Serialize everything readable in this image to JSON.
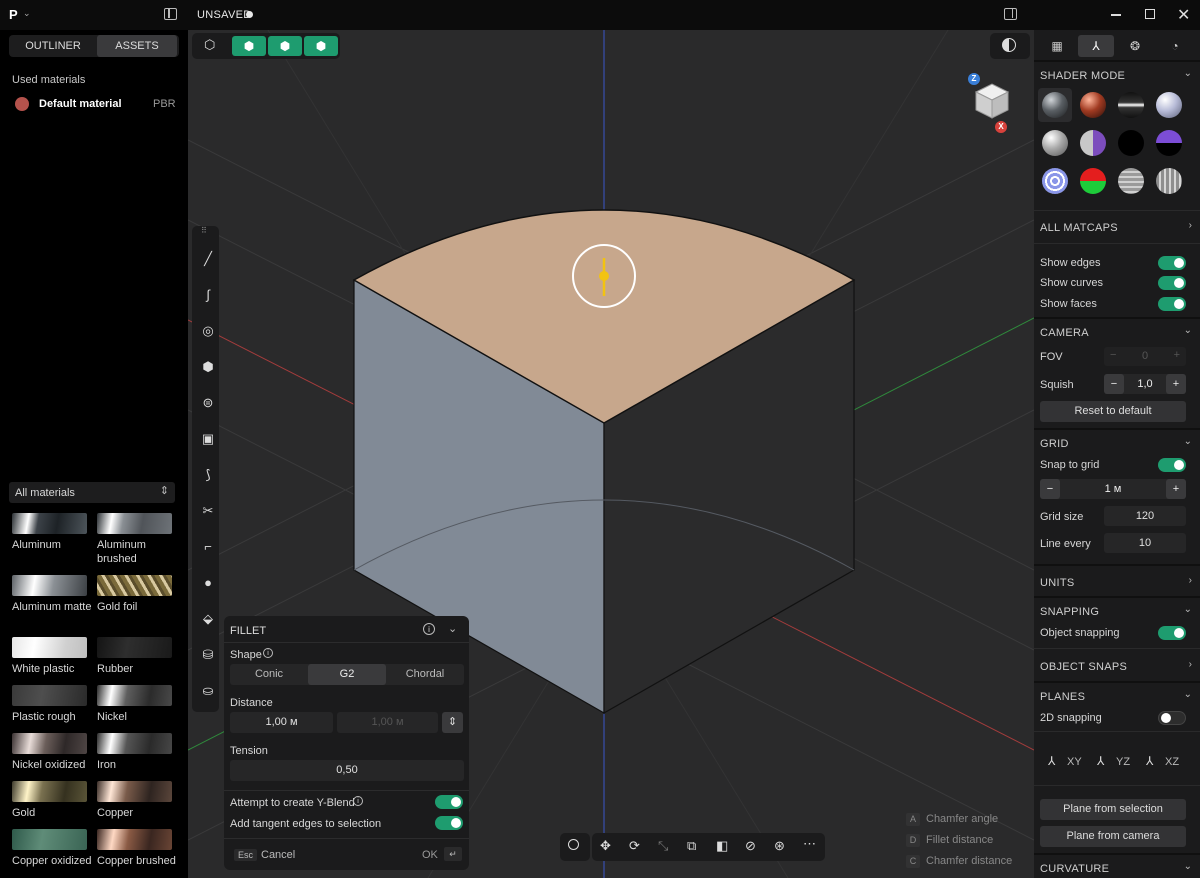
{
  "titlebar": {
    "logo": "P",
    "doc_status": "UNSAVED"
  },
  "left": {
    "tabs": [
      "OUTLINER",
      "ASSETS"
    ],
    "used_header": "Used materials",
    "used_material": {
      "name": "Default material",
      "type": "PBR"
    },
    "filter": "All materials",
    "materials": [
      "Aluminum",
      "Aluminum brushed",
      "Aluminum matte",
      "Gold foil",
      "White plastic",
      "Rubber",
      "Plastic rough",
      "Nickel",
      "Nickel oxidized",
      "Iron",
      "Gold",
      "Copper",
      "Copper oxidized",
      "Copper brushed"
    ]
  },
  "gizmo": {
    "z": "Z",
    "x": "X"
  },
  "fillet": {
    "title": "FILLET",
    "shape_label": "Shape",
    "shapes": [
      "Conic",
      "G2",
      "Chordal"
    ],
    "distance_label": "Distance",
    "distance_a": "1,00 м",
    "distance_b": "1,00 м",
    "tension_label": "Tension",
    "tension": "0,50",
    "yblend": "Attempt to create Y-Blend",
    "tangent": "Add tangent edges to selection",
    "esc": "Esc",
    "cancel": "Cancel",
    "ok": "OK"
  },
  "hints": [
    {
      "key": "A",
      "text": "Chamfer angle"
    },
    {
      "key": "D",
      "text": "Fillet distance"
    },
    {
      "key": "C",
      "text": "Chamfer distance"
    }
  ],
  "right": {
    "shader_mode": "SHADER MODE",
    "all_matcaps": "ALL MATCAPS",
    "show_edges": "Show edges",
    "show_curves": "Show curves",
    "show_faces": "Show faces",
    "camera": "CAMERA",
    "fov": "FOV",
    "fov_value": "0",
    "squish": "Squish",
    "squish_value": "1,0",
    "reset": "Reset to default",
    "grid": "GRID",
    "snap_to_grid": "Snap to grid",
    "grid_step": "1 м",
    "grid_size": "Grid size",
    "grid_size_value": "120",
    "line_every": "Line every",
    "line_every_value": "10",
    "units": "UNITS",
    "snapping": "SNAPPING",
    "object_snapping": "Object snapping",
    "object_snaps": "OBJECT SNAPS",
    "planes": "PLANES",
    "snapping_2d": "2D snapping",
    "plane_xy": "XY",
    "plane_yz": "YZ",
    "plane_xz": "XZ",
    "plane_from_selection": "Plane from selection",
    "plane_from_camera": "Plane from camera",
    "curvature": "CURVATURE"
  },
  "colors": {
    "accent": "#1e9c6f",
    "face_top": "#c7a78c",
    "face_left": "#818a96",
    "face_right": "#2b2b2c"
  }
}
